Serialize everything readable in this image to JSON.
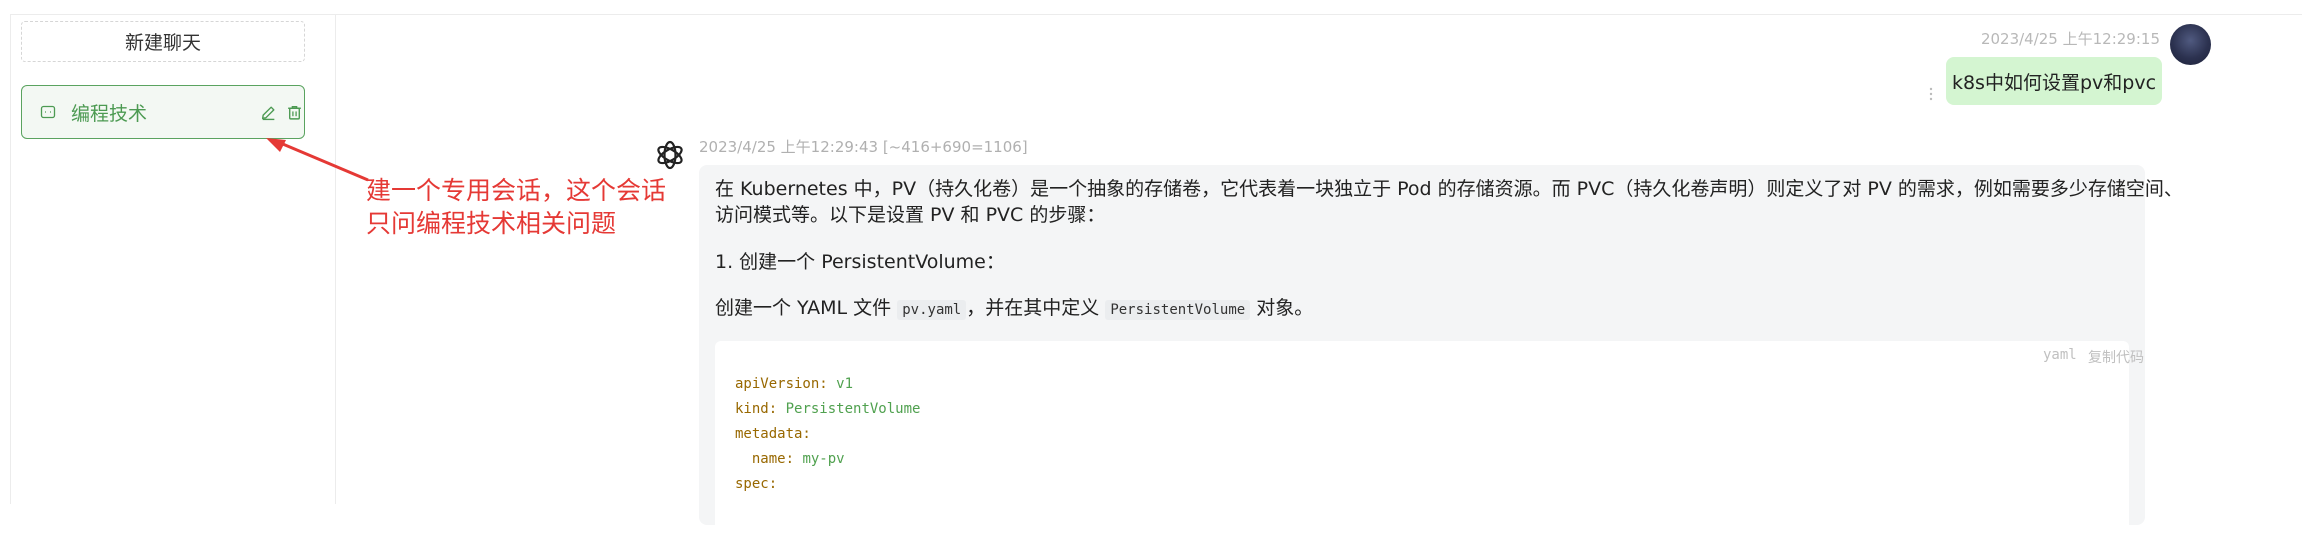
{
  "sidebar": {
    "new_chat_label": "新建聊天",
    "sessions": [
      {
        "title": "编程技术",
        "active": true
      }
    ]
  },
  "annotation": {
    "line1": "建一个专用会话，这个会话",
    "line2": "只问编程技术相关问题",
    "color": "#e53935"
  },
  "user_message": {
    "timestamp": "2023/4/25 上午12:29:15",
    "text": "k8s中如何设置pv和pvc"
  },
  "bot_message": {
    "timestamp": "2023/4/25 上午12:29:43 [~416+690=1106]",
    "paragraph1": "在 Kubernetes 中，PV（持久化卷）是一个抽象的存储卷，它代表着一块独立于 Pod 的存储资源。而 PVC（持久化卷声明）则定义了对 PV 的需求，例如需要多少存储空间、访问模式等。以下是设置 PV 和 PVC 的步骤：",
    "list_item_1": "1. 创建一个 PersistentVolume：",
    "p2_before": "创建一个 YAML 文件",
    "p2_code1": "pv.yaml",
    "p2_middle": "，并在其中定义",
    "p2_code2": "PersistentVolume",
    "p2_after": "对象。",
    "code": {
      "lang": "yaml",
      "copy_label": "复制代码",
      "lines": [
        {
          "key": "apiVersion:",
          "value": "v1"
        },
        {
          "key": "kind:",
          "value": "PersistentVolume"
        },
        {
          "key": "metadata:",
          "value": ""
        },
        {
          "key": "  name:",
          "value": "my-pv"
        },
        {
          "key": "spec:",
          "value": ""
        }
      ]
    }
  },
  "colors": {
    "accent_green": "#4c9a52",
    "user_bubble": "#d4f5d1",
    "bot_bubble": "#f4f5f6"
  }
}
